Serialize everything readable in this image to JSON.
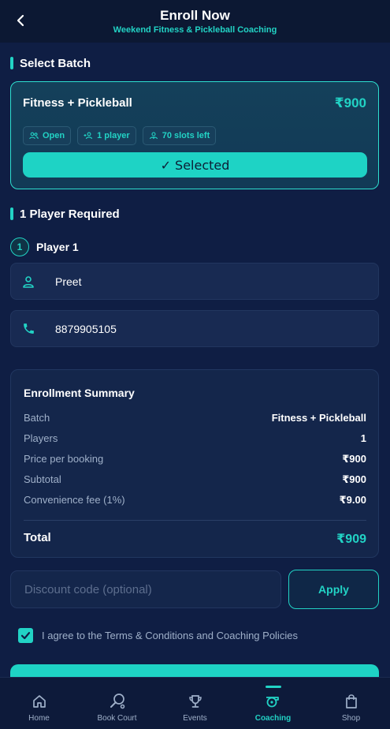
{
  "header": {
    "title": "Enroll Now",
    "subtitle": "Weekend Fitness & Pickleball Coaching",
    "back_icon": "chevron-left-icon"
  },
  "batch_section": {
    "title": "Select Batch",
    "card": {
      "name": "Fitness + Pickleball",
      "price": "₹900",
      "chips": [
        {
          "icon": "group-icon",
          "label": "Open"
        },
        {
          "icon": "add-person-icon",
          "label": "1 player"
        },
        {
          "icon": "slots-icon",
          "label": "70 slots left"
        }
      ],
      "selected_label": "✓ Selected"
    }
  },
  "players_section": {
    "title": "1 Player Required",
    "player": {
      "number": "1",
      "label": "Player 1",
      "name_value": "Preet",
      "phone_value": "8879905105"
    }
  },
  "summary": {
    "title": "Enrollment Summary",
    "rows": [
      {
        "label": "Batch",
        "value": "Fitness + Pickleball"
      },
      {
        "label": "Players",
        "value": "1"
      },
      {
        "label": "Price per booking",
        "value": "₹900"
      },
      {
        "label": "Subtotal",
        "value": "₹900"
      },
      {
        "label": "Convenience fee (1%)",
        "value": "₹9.00"
      }
    ],
    "total_label": "Total",
    "total_value": "₹909"
  },
  "discount": {
    "placeholder": "Discount code (optional)",
    "value": "",
    "apply_label": "Apply"
  },
  "agreement": {
    "checked": true,
    "text": "I agree to the Terms & Conditions and Coaching Policies"
  },
  "tabbar": {
    "tabs": [
      {
        "label": "Home",
        "icon": "home-icon"
      },
      {
        "label": "Book Court",
        "icon": "racket-icon"
      },
      {
        "label": "Events",
        "icon": "trophy-icon"
      },
      {
        "label": "Coaching",
        "icon": "whistle-icon",
        "active": true
      },
      {
        "label": "Shop",
        "icon": "shopping-bag-icon"
      }
    ]
  },
  "colors": {
    "accent": "#22d3c5",
    "background": "#0f1e44",
    "card": "#14264b"
  }
}
